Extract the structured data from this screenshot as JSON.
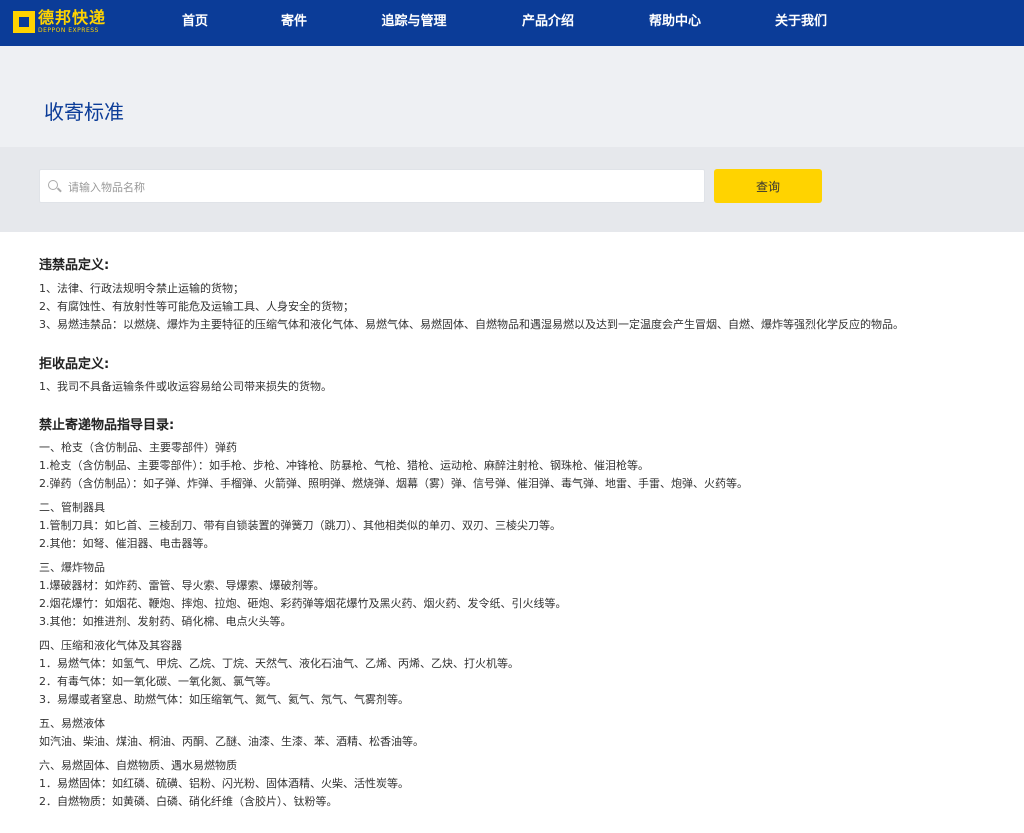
{
  "brand": {
    "name_cn": "德邦快递",
    "name_en": "DEPPON EXPRESS",
    "color": "#0b3c98",
    "accent": "#ffd300"
  },
  "nav": [
    "首页",
    "寄件",
    "追踪与管理",
    "产品介绍",
    "帮助中心",
    "关于我们"
  ],
  "page_title": "收寄标准",
  "search": {
    "placeholder": "请输入物品名称",
    "value": "",
    "button": "查询"
  },
  "sections": {
    "prohibited": {
      "title": "违禁品定义:",
      "items": [
        "1、法律、行政法规明令禁止运输的货物；",
        "2、有腐蚀性、有放射性等可能危及运输工具、人身安全的货物；",
        "3、易燃违禁品：以燃烧、爆炸为主要特征的压缩气体和液化气体、易燃气体、易燃固体、自燃物品和遇湿易燃以及达到一定温度会产生冒烟、自燃、爆炸等强烈化学反应的物品。"
      ]
    },
    "rejected": {
      "title": "拒收品定义:",
      "items": [
        "1、我司不具备运输条件或收运容易给公司带来损失的货物。"
      ]
    },
    "catalog": {
      "title": "禁止寄递物品指导目录:",
      "groups": [
        {
          "heading": "一、枪支（含仿制品、主要零部件）弹药",
          "items": [
            "1.枪支（含仿制品、主要零部件）：如手枪、步枪、冲锋枪、防暴枪、气枪、猎枪、运动枪、麻醉注射枪、钢珠枪、催泪枪等。",
            "2.弹药（含仿制品）：如子弹、炸弹、手榴弹、火箭弹、照明弹、燃烧弹、烟幕（雾）弹、信号弹、催泪弹、毒气弹、地雷、手雷、炮弹、火药等。"
          ]
        },
        {
          "heading": "二、管制器具",
          "items": [
            "1.管制刀具：如匕首、三棱刮刀、带有自锁装置的弹簧刀（跳刀）、其他相类似的单刃、双刃、三棱尖刀等。",
            "2.其他：如弩、催泪器、电击器等。"
          ]
        },
        {
          "heading": "三、爆炸物品",
          "items": [
            "1.爆破器材：如炸药、雷管、导火索、导爆索、爆破剂等。",
            "2.烟花爆竹：如烟花、鞭炮、摔炮、拉炮、砸炮、彩药弹等烟花爆竹及黑火药、烟火药、发令纸、引火线等。",
            "3.其他：如推进剂、发射药、硝化棉、电点火头等。"
          ]
        },
        {
          "heading": "四、压缩和液化气体及其容器",
          "items": [
            "1．易燃气体：如氢气、甲烷、乙烷、丁烷、天然气、液化石油气、乙烯、丙烯、乙炔、打火机等。",
            "2．有毒气体：如一氧化碳、一氧化氮、氯气等。",
            "3．易爆或者窒息、助燃气体：如压缩氧气、氮气、氦气、氖气、气雾剂等。"
          ]
        },
        {
          "heading": "五、易燃液体",
          "items": [
            "如汽油、柴油、煤油、桐油、丙酮、乙醚、油漆、生漆、苯、酒精、松香油等。"
          ]
        },
        {
          "heading": "六、易燃固体、自燃物质、遇水易燃物质",
          "items": [
            "1．易燃固体：如红磷、硫磺、铝粉、闪光粉、固体酒精、火柴、活性炭等。",
            "2．自燃物质：如黄磷、白磷、硝化纤维（含胶片）、钛粉等。"
          ]
        }
      ]
    }
  }
}
